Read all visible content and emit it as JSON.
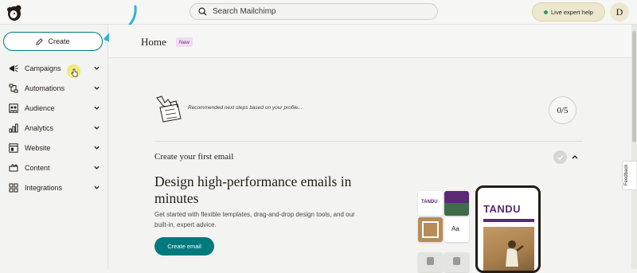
{
  "topbar": {
    "search_placeholder": "Search Mailchimp",
    "expert_label": "Live expert help",
    "avatar_initial": "D"
  },
  "sidebar": {
    "create_label": "Create",
    "items": [
      {
        "label": "Campaigns",
        "icon": "megaphone-icon"
      },
      {
        "label": "Automations",
        "icon": "automation-icon"
      },
      {
        "label": "Audience",
        "icon": "audience-icon"
      },
      {
        "label": "Analytics",
        "icon": "bar-chart-icon"
      },
      {
        "label": "Website",
        "icon": "website-icon"
      },
      {
        "label": "Content",
        "icon": "content-icon"
      },
      {
        "label": "Integrations",
        "icon": "grid-icon"
      }
    ]
  },
  "main": {
    "title": "Home",
    "badge": "New",
    "recommendation_text": "Recommended next steps based on your profile...",
    "progress": "0/5",
    "section_title": "Create your first email",
    "headline": "Design high-performance emails in minutes",
    "description": "Get started with flexible templates, drag-and-drop design tools, and our built-in, expert advice.",
    "cta_label": "Create email",
    "preview_brand": "TANDU",
    "tile_brand": "TANDU",
    "tile_font_sample": "Aa"
  },
  "feedback_label": "Feedback",
  "colors": {
    "accent": "#017a7e",
    "brand_purple": "#5a2a75",
    "badge_bg": "#f0dcf4",
    "expert_bg": "#ece8cf"
  }
}
